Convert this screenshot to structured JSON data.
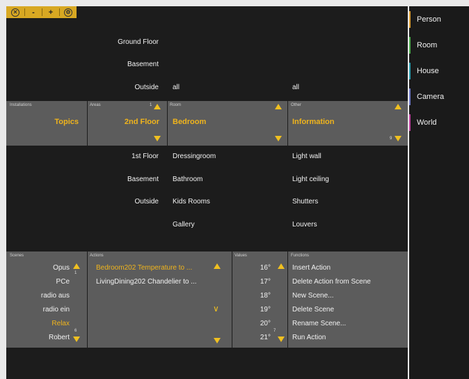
{
  "toolbar": {
    "close_glyph": "✕",
    "minus_label": "-",
    "plus_label": "+",
    "settings_glyph": "⚙"
  },
  "floors_top": {
    "row1": "Ground Floor",
    "row2": "Basement",
    "row3": "Outside",
    "room_all": "all",
    "other_all": "all"
  },
  "headers": {
    "installations": "Installations",
    "areas": "Areas",
    "room": "Room",
    "other": "Other",
    "areas_count": "1",
    "other_count": "9"
  },
  "selected": {
    "installation": "Topics",
    "area": "2nd Floor",
    "room": "Bedroom",
    "other": "Information"
  },
  "areas_below": [
    "1st Floor",
    "Basement",
    "Outside"
  ],
  "rooms_below": [
    "Dressingroom",
    "Bathroom",
    "Kids Rooms",
    "Gallery"
  ],
  "other_below": [
    "Light wall",
    "Light ceiling",
    "Shutters",
    "Louvers"
  ],
  "panel_headers": {
    "scenes": "Scenes",
    "actions": "Actions",
    "values": "Values",
    "functions": "Functions"
  },
  "scenes": [
    "Opus",
    "PCe",
    "radio aus",
    "radio ein",
    "Relax",
    "Robert"
  ],
  "scene_counts": {
    "top": "1",
    "bottom": "6"
  },
  "actions": [
    "Bedroom202 Temperature to ...",
    "LivingDining202 Chandelier to ..."
  ],
  "action_chevron": "∨",
  "values": [
    "16°",
    "17°",
    "18°",
    "19°",
    "20°",
    "21°"
  ],
  "values_count": "7",
  "functions": [
    "Insert Action",
    "Delete Action from Scene",
    "New Scene...",
    "Delete Scene",
    "Rename Scene...",
    "Run Action"
  ],
  "sidebar": {
    "items": [
      {
        "label": "Person",
        "color": "#e0a030"
      },
      {
        "label": "Room",
        "color": "#4cae4c"
      },
      {
        "label": "House",
        "color": "#2a9fb0"
      },
      {
        "label": "Camera",
        "color": "#6e78c8"
      },
      {
        "label": "World",
        "color": "#c040a0"
      }
    ]
  },
  "colors": {
    "accent": "#f0b41c",
    "panel": "#5c5c5c",
    "background": "#1c1c1c"
  }
}
